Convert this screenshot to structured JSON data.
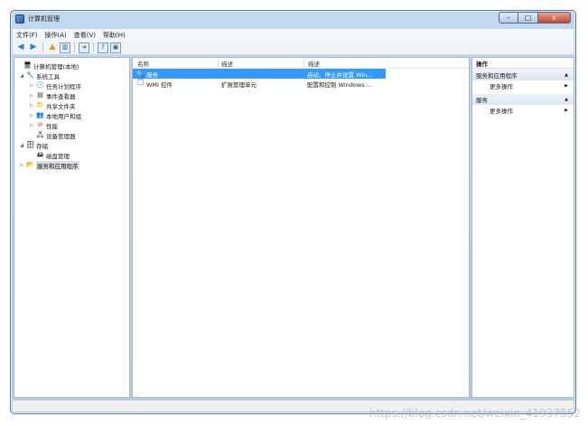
{
  "window": {
    "title": "计算机管理",
    "controls": {
      "minimize": "–",
      "maximize": "□",
      "close": "x"
    }
  },
  "menu": [
    "文件(F)",
    "操作(A)",
    "查看(V)",
    "帮助(H)"
  ],
  "toolbar": {
    "icons": [
      "back-arrow-icon",
      "forward-arrow-icon",
      "up-folder-icon",
      "console-tree-icon",
      "export-icon",
      "help-icon",
      "properties-icon"
    ]
  },
  "tree": [
    {
      "label": "计算机管理(本地)",
      "level": 0,
      "twisty": "",
      "icon": "🖥"
    },
    {
      "label": "系统工具",
      "level": 1,
      "twisty": "◢",
      "icon": "🔧"
    },
    {
      "label": "任务计划程序",
      "level": 2,
      "twisty": "▷",
      "icon": "🕒"
    },
    {
      "label": "事件查看器",
      "level": 2,
      "twisty": "▷",
      "icon": "▤"
    },
    {
      "label": "共享文件夹",
      "level": 2,
      "twisty": "▷",
      "icon": "📁"
    },
    {
      "label": "本地用户和组",
      "level": 2,
      "twisty": "▷",
      "icon": "👥"
    },
    {
      "label": "性能",
      "level": 2,
      "twisty": "▷",
      "icon": "⊘"
    },
    {
      "label": "设备管理器",
      "level": 2,
      "twisty": "",
      "icon": "🖧"
    },
    {
      "label": "存储",
      "level": 1,
      "twisty": "◢",
      "icon": "🗄"
    },
    {
      "label": "磁盘管理",
      "level": 2,
      "twisty": "",
      "icon": "🖴"
    },
    {
      "label": "服务和应用程序",
      "level": 1,
      "twisty": "▷",
      "icon": "📂",
      "selected": true
    }
  ],
  "list": {
    "columns": [
      "名称",
      "描述",
      "描述"
    ],
    "rows": [
      {
        "icon": "🔍",
        "name": "服务",
        "desc": "",
        "comment": "启动、停止并设置 Win...",
        "selected": true
      },
      {
        "icon": "🗔",
        "name": "WMI 控件",
        "desc": "扩展管理单元",
        "comment": "配置和控制 Windows ...",
        "selected": false
      }
    ]
  },
  "actions": {
    "header": "操作",
    "sections": [
      {
        "title": "服务和应用程序",
        "items": [
          "更多操作"
        ]
      },
      {
        "title": "服务",
        "items": [
          "更多操作"
        ]
      }
    ]
  },
  "watermark": "https://blog.csdn.net/weixin_41937552"
}
